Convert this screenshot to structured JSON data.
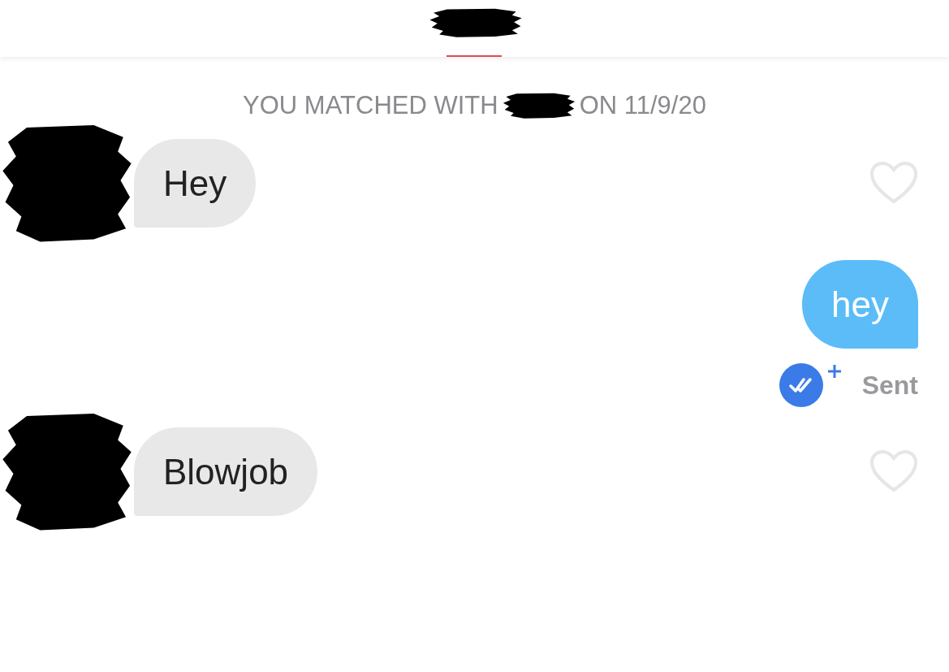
{
  "match_notice": {
    "before": "YOU MATCHED WITH",
    "after": "ON 11/9/20"
  },
  "messages": [
    {
      "kind": "received",
      "text": "Hey",
      "liked": false
    },
    {
      "kind": "sent",
      "text": "hey",
      "status": "Sent"
    },
    {
      "kind": "received",
      "text": "Blowjob",
      "liked": false
    }
  ]
}
